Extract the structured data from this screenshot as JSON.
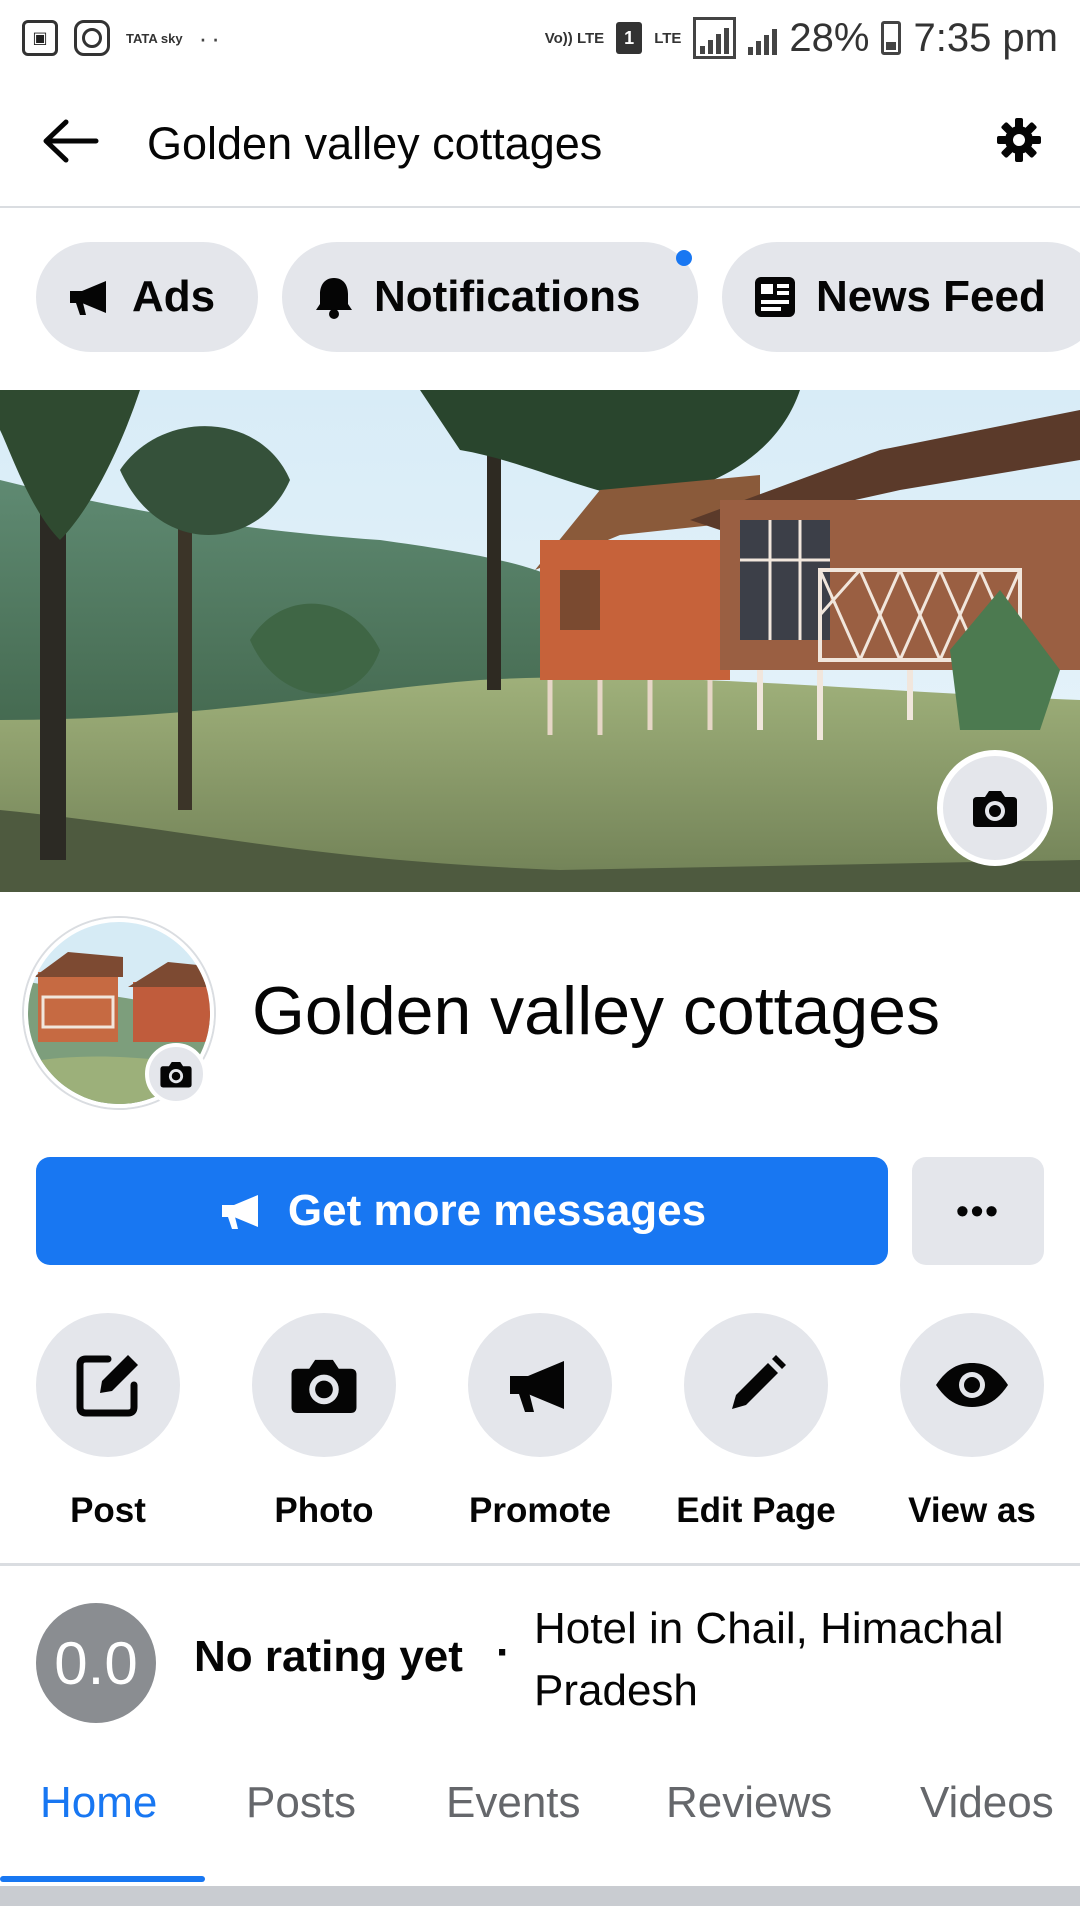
{
  "status_bar": {
    "left_icons": [
      "gallery-icon",
      "instagram-icon",
      "tata-sky-icon",
      "more-notifications-icon"
    ],
    "tata_label": "TATA sky",
    "volte": "Vo)) LTE",
    "sim": "1",
    "lte": "LTE",
    "battery": "28%",
    "time": "7:35 pm"
  },
  "header": {
    "title": "Golden valley cottages",
    "back_icon": "arrow-left-icon",
    "settings_icon": "gear-icon"
  },
  "chips": [
    {
      "label": "Ads",
      "icon": "megaphone-icon"
    },
    {
      "label": "Notifications",
      "icon": "bell-icon",
      "has_dot": true
    },
    {
      "label": "News Feed",
      "icon": "news-feed-icon"
    }
  ],
  "profile": {
    "name": "Golden valley cottages",
    "cta_label": "Get more messages",
    "more_label": "•••"
  },
  "actions": [
    {
      "label": "Post",
      "icon": "edit-square-icon"
    },
    {
      "label": "Photo",
      "icon": "camera-icon"
    },
    {
      "label": "Promote",
      "icon": "megaphone-icon"
    },
    {
      "label": "Edit Page",
      "icon": "pencil-icon"
    },
    {
      "label": "View as",
      "icon": "eye-icon"
    }
  ],
  "rating": {
    "value": "0.0",
    "text": "No rating yet",
    "separator": "·",
    "category": "Hotel in Chail, Himachal Pradesh"
  },
  "tabs": [
    {
      "label": "Home",
      "active": true
    },
    {
      "label": "Posts"
    },
    {
      "label": "Events"
    },
    {
      "label": "Reviews"
    },
    {
      "label": "Videos"
    }
  ],
  "colors": {
    "accent": "#1877f2",
    "chip_bg": "#e4e6eb",
    "rating_bg": "#8a8d91"
  }
}
